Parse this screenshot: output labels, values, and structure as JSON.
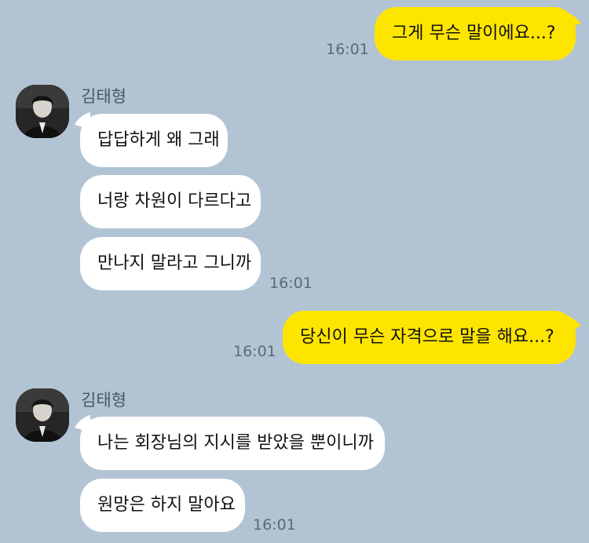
{
  "messages": [
    {
      "sender": "me",
      "text": "그게 무슨 말이에요...?",
      "time": "16:01"
    },
    {
      "sender": "김태형",
      "text": "답답하게 왜 그래"
    },
    {
      "sender": "김태형",
      "text": "너랑 차원이 다르다고"
    },
    {
      "sender": "김태형",
      "text": "만나지 말라고 그니까",
      "time": "16:01"
    },
    {
      "sender": "me",
      "text": "당신이 무슨 자격으로 말을 해요...?",
      "time": "16:01"
    },
    {
      "sender": "김태형",
      "text": "나는 회장님의 지시를 받았을 뿐이니까"
    },
    {
      "sender": "김태형",
      "text": "원망은 하지 말아요",
      "time": "16:01"
    }
  ],
  "contact": {
    "name": "김태형",
    "avatar_icon": "profile-photo"
  },
  "colors": {
    "background": "#b2c4d4",
    "my_bubble": "#fee500",
    "their_bubble": "#ffffff",
    "timestamp": "#5c6a78"
  }
}
